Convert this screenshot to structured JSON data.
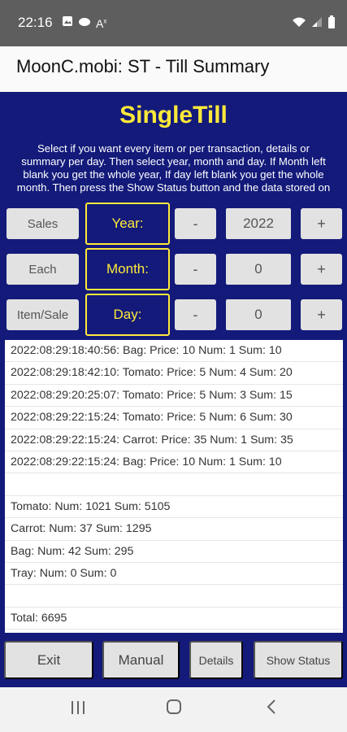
{
  "status_bar": {
    "time": "22:16"
  },
  "app_bar": {
    "title": "MoonC.mobi: ST - Till Summary"
  },
  "app": {
    "title": "SingleTill",
    "instructions": [
      "Select if you want every item or per transaction, details or",
      "summary per day. Then select year, month and day. If Month left",
      "blank you get the whole year, If day left blank you get the whole",
      "month. Then press the Show Status button and the data stored on"
    ]
  },
  "controls": {
    "rows": [
      {
        "left": "Sales",
        "label": "Year:",
        "minus": "-",
        "value": "2022",
        "plus": "+"
      },
      {
        "left": "Each",
        "label": "Month:",
        "minus": "-",
        "value": "0",
        "plus": "+"
      },
      {
        "left": "Item/Sale",
        "label": "Day:",
        "minus": "-",
        "value": "0",
        "plus": "+"
      }
    ]
  },
  "list": {
    "items": [
      "2022:08:29:18:40:56: Bag: Price: 10 Num: 1 Sum: 10",
      "2022:08:29:18:42:10: Tomato: Price: 5 Num: 4 Sum: 20",
      "2022:08:29:20:25:07: Tomato: Price: 5 Num: 3 Sum: 15",
      "2022:08:29:22:15:24: Tomato: Price: 5 Num: 6 Sum: 30",
      "2022:08:29:22:15:24: Carrot: Price: 35 Num: 1 Sum: 35",
      "2022:08:29:22:15:24: Bag: Price: 10 Num: 1 Sum: 10",
      "",
      "Tomato: Num: 1021 Sum: 5105",
      "Carrot: Num: 37 Sum: 1295",
      "Bag: Num: 42 Sum: 295",
      "Tray: Num: 0 Sum: 0",
      "",
      "Total: 6695"
    ]
  },
  "bottom": {
    "exit": "Exit",
    "manual": "Manual",
    "details": "Details",
    "show_status": "Show Status"
  }
}
